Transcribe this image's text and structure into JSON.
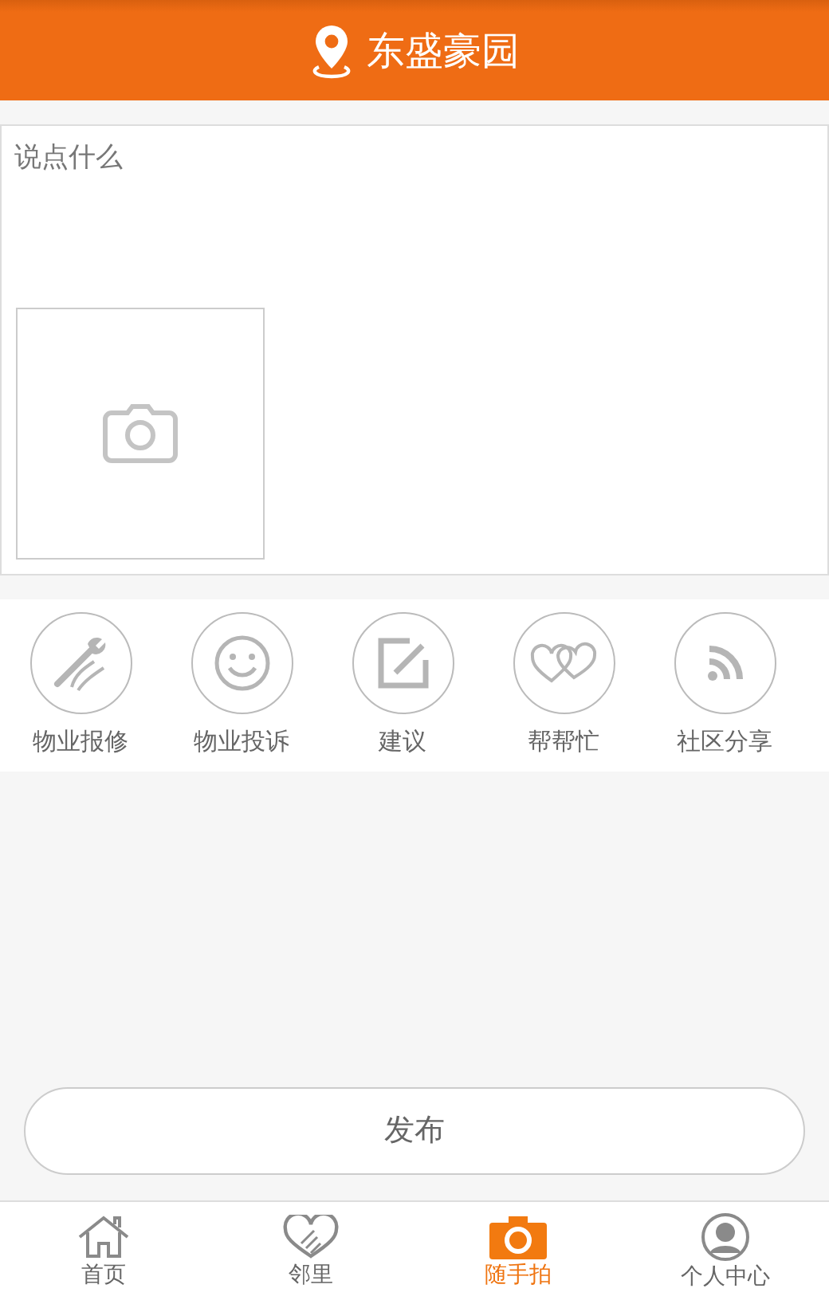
{
  "header": {
    "title": "东盛豪园"
  },
  "post": {
    "placeholder": "说点什么"
  },
  "categories": [
    {
      "label": "物业报修"
    },
    {
      "label": "物业投诉"
    },
    {
      "label": "建议"
    },
    {
      "label": "帮帮忙"
    },
    {
      "label": "社区分享"
    }
  ],
  "publish_button": "发布",
  "tab_bar": [
    {
      "label": "首页",
      "selected": false
    },
    {
      "label": "邻里",
      "selected": false
    },
    {
      "label": "随手拍",
      "selected": true
    },
    {
      "label": "个人中心",
      "selected": false
    }
  ]
}
